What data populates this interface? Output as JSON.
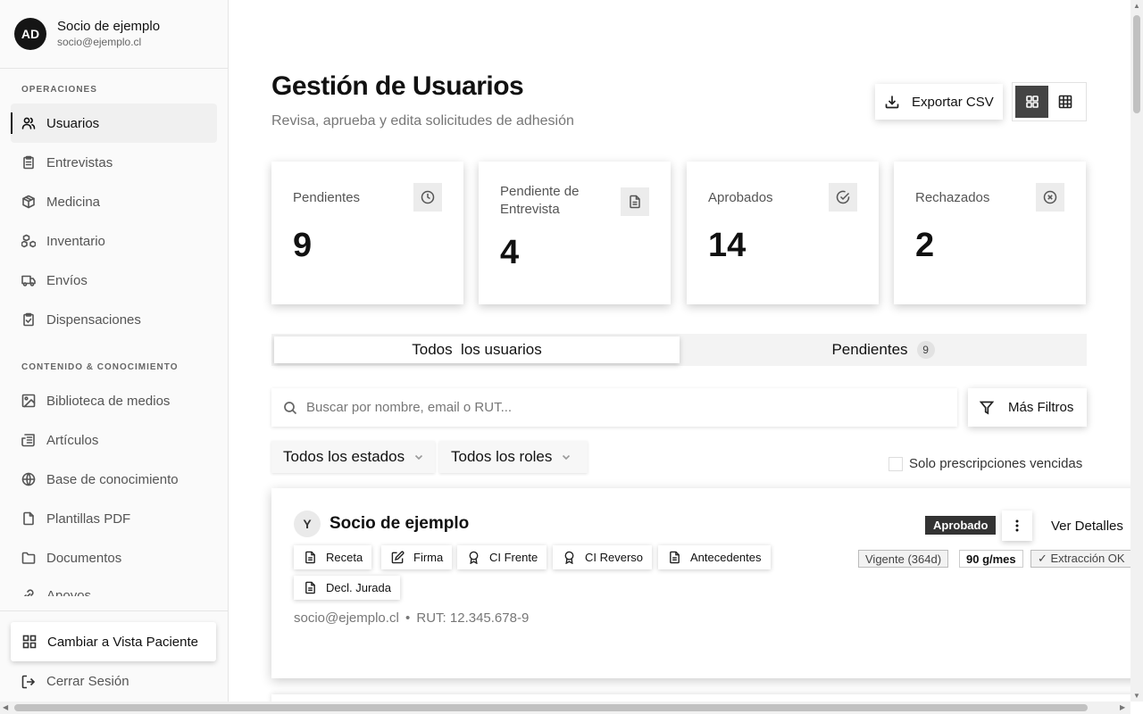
{
  "profile": {
    "initials": "AD",
    "name": "Socio de ejemplo",
    "email": "socio@ejemplo.cl"
  },
  "sidebar": {
    "section_ops": "OPERACIONES",
    "section_content": "CONTENIDO & CONOCIMIENTO",
    "ops_items": [
      {
        "label": "Usuarios",
        "icon": "users-icon",
        "active": true
      },
      {
        "label": "Entrevistas",
        "icon": "clipboard-icon"
      },
      {
        "label": "Medicina",
        "icon": "package-icon"
      },
      {
        "label": "Inventario",
        "icon": "boxes-icon"
      },
      {
        "label": "Envíos",
        "icon": "truck-icon"
      },
      {
        "label": "Dispensaciones",
        "icon": "clipboard-check-icon"
      }
    ],
    "content_items": [
      {
        "label": "Biblioteca de medios",
        "icon": "image-icon"
      },
      {
        "label": "Artículos",
        "icon": "newspaper-icon"
      },
      {
        "label": "Base de conocimiento",
        "icon": "globe-icon"
      },
      {
        "label": "Plantillas PDF",
        "icon": "file-icon"
      },
      {
        "label": "Documentos",
        "icon": "folder-icon"
      },
      {
        "label": "Apoyos",
        "icon": "link-icon"
      }
    ],
    "switch_view": "Cambiar a Vista Paciente",
    "logout": "Cerrar Sesión"
  },
  "header": {
    "title": "Gestión de Usuarios",
    "subtitle": "Revisa, aprueba y edita solicitudes de adhesión",
    "export_label": "Exportar CSV"
  },
  "stats": [
    {
      "label": "Pendientes",
      "value": "9",
      "icon": "clock-icon"
    },
    {
      "label": "Pendiente de Entrevista",
      "value": "4",
      "icon": "file-text-icon"
    },
    {
      "label": "Aprobados",
      "value": "14",
      "icon": "check-circle-icon"
    },
    {
      "label": "Rechazados",
      "value": "2",
      "icon": "x-circle-icon"
    }
  ],
  "tabs": {
    "all": "Todos  los usuarios",
    "pending": "Pendientes",
    "pending_count": "9"
  },
  "search": {
    "placeholder": "Buscar por nombre, email o RUT...",
    "value": ""
  },
  "filters": {
    "more_label": "Más Filtros",
    "status_select": "Todos los estados",
    "role_select": "Todos los roles",
    "expired_only": "Solo prescripciones vencidas"
  },
  "user_card": {
    "initial": "Y",
    "name": "Socio de ejemplo",
    "status": "Aprobado",
    "details_label": "Ver Detalles",
    "documents": [
      "Receta",
      "Firma",
      "CI Frente",
      "CI Reverso",
      "Antecedentes",
      "Decl. Jurada"
    ],
    "badges": [
      "Vigente (364d)",
      "90 g/mes",
      "✓ Extracción OK"
    ],
    "email": "socio@ejemplo.cl",
    "rut": "RUT: 12.345.678-9",
    "separator": "•"
  },
  "colors": {
    "accent": "#111111",
    "badge_bg": "#333333",
    "sidebar_bg": "#fafafa"
  }
}
